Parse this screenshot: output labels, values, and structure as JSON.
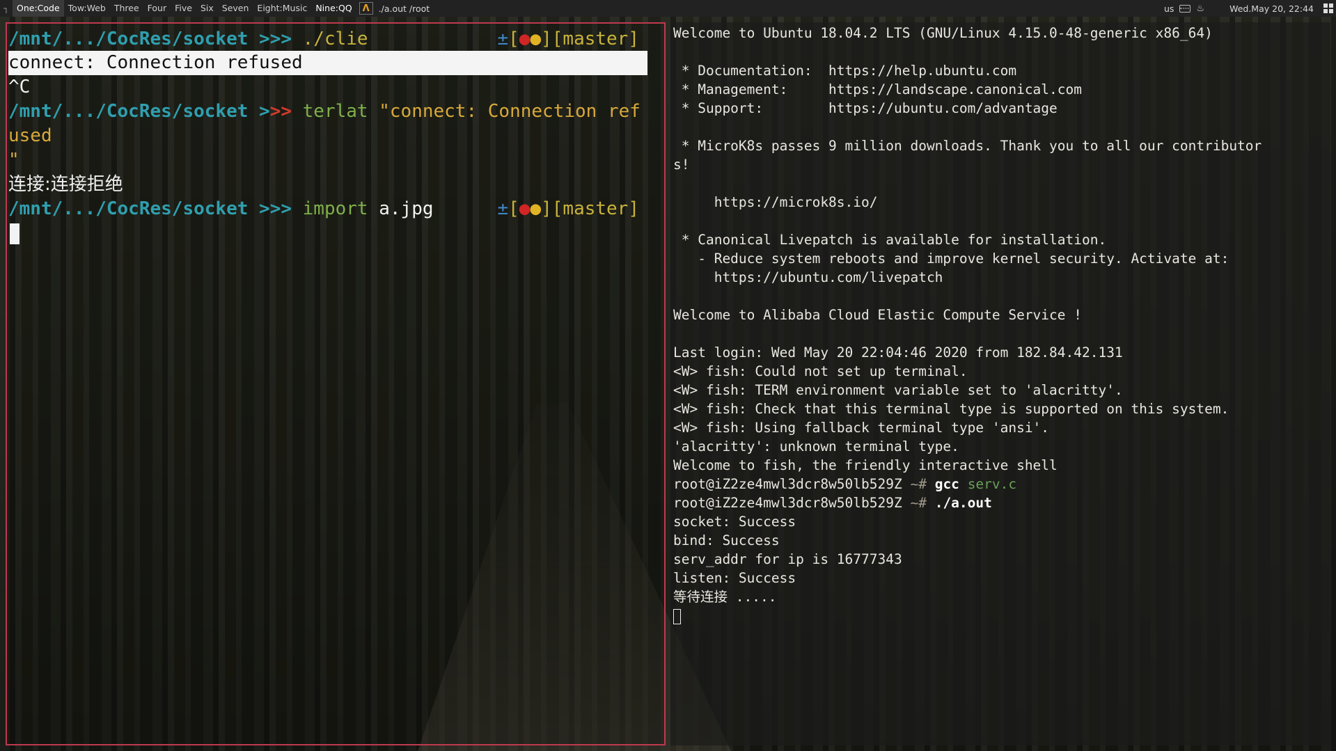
{
  "topbar": {
    "workspaces": [
      {
        "label": "One:Code",
        "active": true
      },
      {
        "label": "Tow:Web",
        "active": false
      },
      {
        "label": "Three",
        "active": false
      },
      {
        "label": "Four",
        "active": false
      },
      {
        "label": "Five",
        "active": false
      },
      {
        "label": "Six",
        "active": false
      },
      {
        "label": "Seven",
        "active": false
      },
      {
        "label": "Eight:Music",
        "active": false
      },
      {
        "label": "Nine:QQ",
        "active": false
      }
    ],
    "app_icon": "alacritty-icon",
    "app_icon_glyph": "Λ",
    "window_title": "./a.out  /root",
    "keyboard_layout": "us",
    "clock": "Wed.May 20, 22:44"
  },
  "left_terminal": {
    "prompt_path": "/mnt/.../CocRes/socket",
    "prompt_arrows_a": ">",
    "prompt_arrows_b": ">>",
    "git_plus": "±",
    "git_open": "[",
    "git_dot1": "●",
    "git_dot2": "●",
    "git_close": "]",
    "git_branch": "[master]",
    "cmd1": "./clie",
    "highlight_line": "connect: Connection refused",
    "ctrl_c": "^C",
    "cmd2": "terlat",
    "cmd2_arg_part1": "\"connect: Connection ref",
    "cmd2_arg_part2": "used",
    "cmd2_arg_part3": "\"",
    "translation": "连接:连接拒绝",
    "cmd3": "import",
    "cmd3_arg": "a.jpg"
  },
  "right_terminal": {
    "lines": [
      "Welcome to Ubuntu 18.04.2 LTS (GNU/Linux 4.15.0-48-generic x86_64)",
      "",
      " * Documentation:  https://help.ubuntu.com",
      " * Management:     https://landscape.canonical.com",
      " * Support:        https://ubuntu.com/advantage",
      "",
      " * MicroK8s passes 9 million downloads. Thank you to all our contributor",
      "s!",
      "",
      "     https://microk8s.io/",
      "",
      " * Canonical Livepatch is available for installation.",
      "   - Reduce system reboots and improve kernel security. Activate at:",
      "     https://ubuntu.com/livepatch",
      "",
      "Welcome to Alibaba Cloud Elastic Compute Service !",
      "",
      "Last login: Wed May 20 22:04:46 2020 from 182.84.42.131",
      "<W> fish: Could not set up terminal.",
      "<W> fish: TERM environment variable set to 'alacritty'.",
      "<W> fish: Check that this terminal type is supported on this system.",
      "<W> fish: Using fallback terminal type 'ansi'.",
      "'alacritty': unknown terminal type.",
      "Welcome to fish, the friendly interactive shell"
    ],
    "host": "root@iZ2ze4mwl3dcr8w50lb529Z",
    "prompt_suffix": " ~# ",
    "cmd_gcc": "gcc",
    "cmd_gcc_arg": "serv.c",
    "cmd_run": "./a.out",
    "output": [
      "socket: Success",
      "bind: Success",
      "serv_addr for ip is 16777343",
      "listen: Success",
      "等待连接 ....."
    ]
  }
}
